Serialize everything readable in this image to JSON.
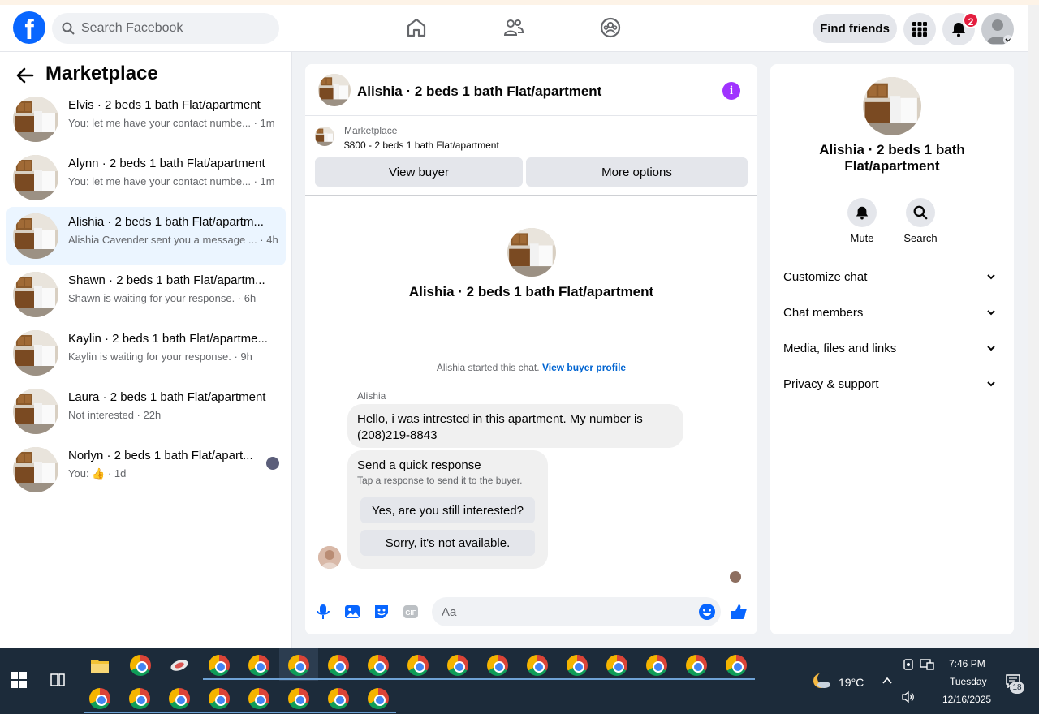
{
  "topbar": {
    "logo": "f",
    "search_placeholder": "Search Facebook",
    "find_friends": "Find friends",
    "notification_count": "2"
  },
  "left": {
    "title": "Marketplace",
    "conversations": [
      {
        "name": "Elvis · 2 beds 1 bath Flat/apartment",
        "preview": "You: let me have your contact numbe... · 1m"
      },
      {
        "name": "Alynn · 2 beds 1 bath Flat/apartment",
        "preview": "You: let me have your contact numbe... · 1m"
      },
      {
        "name": "Alishia · 2 beds 1 bath Flat/apartm...",
        "preview": "Alishia Cavender sent you a message ... · 4h"
      },
      {
        "name": "Shawn · 2 beds 1 bath Flat/apartm...",
        "preview": "Shawn is waiting for your response. · 6h"
      },
      {
        "name": "Kaylin · 2 beds 1 bath Flat/apartme...",
        "preview": "Kaylin is waiting for your response. · 9h"
      },
      {
        "name": "Laura · 2 beds 1 bath Flat/apartment",
        "preview": "Not interested · 22h"
      },
      {
        "name": "Norlyn · 2 beds 1 bath Flat/apart...",
        "preview": "You: 👍 · 1d"
      }
    ]
  },
  "chat": {
    "title": "Alishia · 2 beds 1 bath Flat/apartment",
    "listing_label": "Marketplace",
    "listing_price": "$800 - 2 beds 1 bath Flat/apartment",
    "view_buyer": "View buyer",
    "more_options": "More options",
    "intro_title": "Alishia · 2 beds 1 bath Flat/apartment",
    "started_text": "Alishia started this chat.",
    "view_buyer_profile": "View buyer profile",
    "sender": "Alishia",
    "message_line1": "Hello, i was intrested in this apartment. My number is",
    "message_line2": "(208)219-8843",
    "quick_title": "Send a quick response",
    "quick_sub": "Tap a response to send it to the buyer.",
    "quick_yes": "Yes, are you still interested?",
    "quick_no": "Sorry, it's not available.",
    "input_placeholder": "Aa"
  },
  "right": {
    "title": "Alishia · 2 beds 1 bath Flat/apartment",
    "mute": "Mute",
    "search": "Search",
    "sections": [
      "Customize chat",
      "Chat members",
      "Media, files and links",
      "Privacy & support"
    ]
  },
  "taskbar": {
    "temperature": "19°C",
    "time": "7:46 PM",
    "day": "Tuesday",
    "date": "12/16/2025",
    "notif_count": "18"
  },
  "colors": {
    "brand": "#0866ff",
    "accent_purple": "#a033ff",
    "active_row": "#ebf5ff"
  }
}
